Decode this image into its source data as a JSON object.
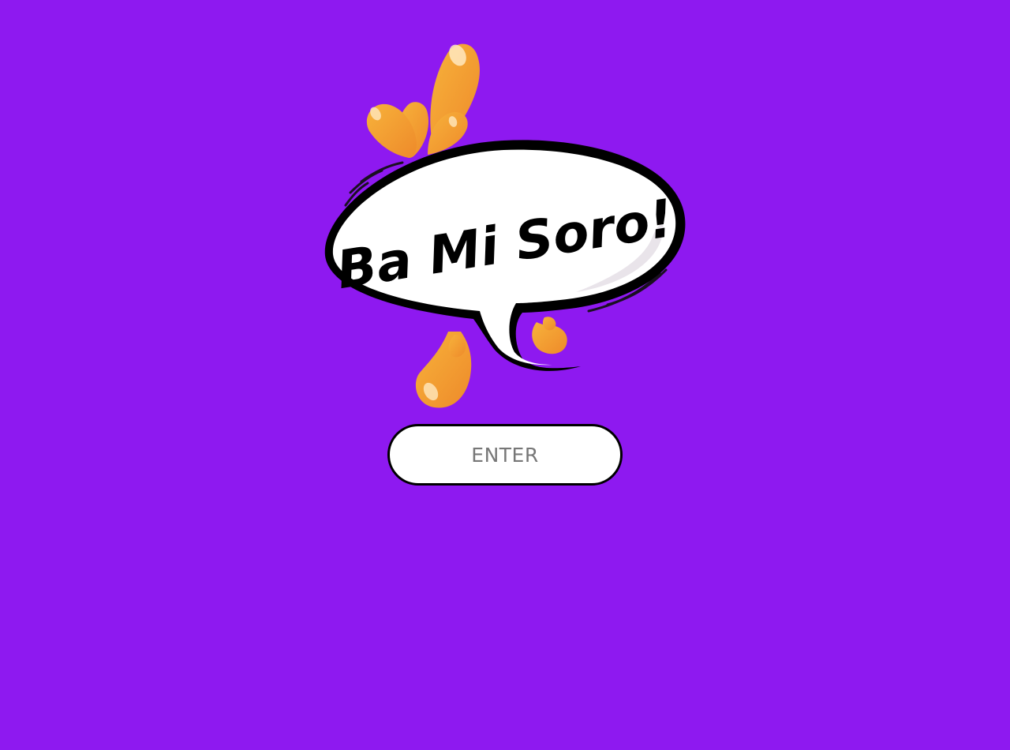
{
  "page": {
    "background_color": "#8e19f0"
  },
  "logo": {
    "text": "Ba Mi Soro!",
    "splash_color": "#f39a2c",
    "bubble_fill": "#ffffff",
    "bubble_outline": "#000000"
  },
  "enter_button": {
    "label": "ENTER",
    "fill": "#ffffff",
    "border": "#000000",
    "text_color": "#777777"
  }
}
